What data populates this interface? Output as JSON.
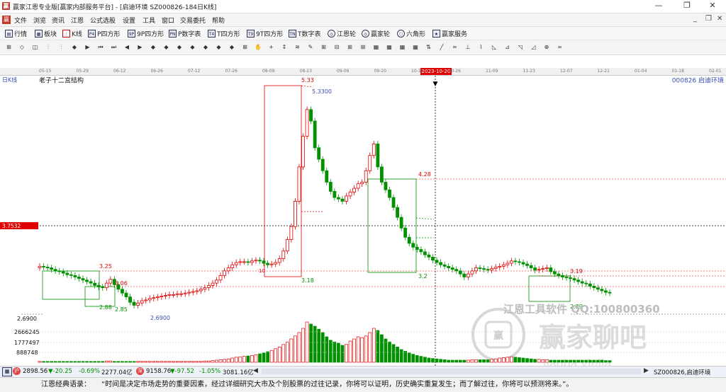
{
  "window": {
    "title": "赢家江恩专业版[赢家内部服务平台] - [启迪环境  SZ000826-184日K线]",
    "controls": [
      "—",
      "❐",
      "✕"
    ]
  },
  "menubar": {
    "items": [
      "文件",
      "浏览",
      "资讯",
      "江恩",
      "公式选股",
      "设置",
      "工具",
      "窗口",
      "交易委托",
      "帮助"
    ],
    "mdi_controls": [
      "_",
      "❐",
      "✕"
    ]
  },
  "toolbar": {
    "items": [
      {
        "label": "行情",
        "icon": "quote-icon"
      },
      {
        "label": "板块",
        "icon": "sector-icon"
      },
      {
        "label": "K线",
        "icon": "kline-icon"
      },
      {
        "label": "P四方形",
        "icon": "p-square-icon",
        "badge": "P4"
      },
      {
        "label": "9P四方形",
        "icon": "9p-square-icon",
        "badge": "9P"
      },
      {
        "label": "P数字表",
        "icon": "p-table-icon",
        "badge": "PN"
      },
      {
        "label": "T四方形",
        "icon": "t-square-icon",
        "badge": "T4"
      },
      {
        "label": "9T四方形",
        "icon": "9t-square-icon",
        "badge": "T9"
      },
      {
        "label": "T数字表",
        "icon": "t-table-icon",
        "badge": "TN"
      },
      {
        "label": "江恩轮",
        "icon": "gann-wheel-icon",
        "badge": "◎"
      },
      {
        "label": "赢家轮",
        "icon": "winner-wheel-icon",
        "badge": "◎"
      },
      {
        "label": "六角形",
        "icon": "hexagon-icon",
        "badge": "⬡"
      },
      {
        "label": "赢家服务",
        "icon": "service-icon",
        "badge": "★"
      }
    ]
  },
  "drawing_tools": [
    "⊞",
    "◇",
    "◫",
    "⫶",
    "⫶",
    "◆",
    "▶",
    "⏮",
    "⏭",
    "◀",
    "▶",
    "◆",
    "◆",
    "◆",
    "◆",
    "◆",
    "◆",
    "◆",
    "⊞",
    "✋",
    "+",
    "↕",
    "≋",
    "✎",
    "⊞",
    "⊟",
    "⊞",
    "⊞",
    "▦",
    "▦",
    "▦",
    "▦",
    "⇅",
    "╱",
    "≈",
    "⊥",
    "⌇",
    "◺",
    "⊿",
    "◹",
    "◿",
    "⊕",
    "∞"
  ],
  "date_axis": {
    "labels": [
      "05-15",
      "05-29",
      "06-12",
      "06-26",
      "07-12",
      "07-26",
      "08-09",
      "08-23",
      "09-06",
      "09-20",
      "10-12",
      "10-26",
      "11-09",
      "11-23",
      "12-07",
      "12-21",
      "01-04",
      "01-18",
      "02-01"
    ],
    "selected": "2023-10-20"
  },
  "chart": {
    "period_label": "日K线",
    "study_name": "老子十二宫结构",
    "stock": "000826  启迪环境",
    "crosshair_price": "3.7532",
    "ylabel_left": "2.6900",
    "volume_ticks": [
      "2666245",
      "1777497",
      "888748"
    ],
    "annotations": {
      "high": "5.33",
      "high_label": "5.3300",
      "low_label": "2.6900",
      "box_labels": [
        "3.25",
        "3.06",
        "2.88",
        "2.85",
        "3.18",
        "4.28",
        "3.19",
        "2.89",
        "3.2"
      ],
      "extra": "10"
    },
    "watermark_text": "江恩工具软件  QQ:100800360",
    "watermark_logo_text": "赢家聊吧",
    "watermark_url": "liaoba.yinjia"
  },
  "chart_data": {
    "type": "candlestick",
    "colors": {
      "up": "#e00000",
      "down": "#009000"
    },
    "closes": [
      3.2,
      3.19,
      3.18,
      3.16,
      3.14,
      3.13,
      3.11,
      3.09,
      3.08,
      3.06,
      3.04,
      3.02,
      3.0,
      2.98,
      2.95,
      2.93,
      2.92,
      2.98,
      3.03,
      2.96,
      2.9,
      2.85,
      2.8,
      2.73,
      2.69,
      2.72,
      2.75,
      2.76,
      2.78,
      2.79,
      2.8,
      2.81,
      2.82,
      2.83,
      2.83,
      2.84,
      2.84,
      2.85,
      2.86,
      2.87,
      2.88,
      2.9,
      2.92,
      2.95,
      2.98,
      3.02,
      3.08,
      3.14,
      3.18,
      3.22,
      3.25,
      3.26,
      3.26,
      3.25,
      3.27,
      3.28,
      3.27,
      3.24,
      3.22,
      3.23,
      3.25,
      3.3,
      3.4,
      3.55,
      3.72,
      4.05,
      4.5,
      4.9,
      5.25,
      5.1,
      4.75,
      4.6,
      4.45,
      4.3,
      4.18,
      4.1,
      4.08,
      4.05,
      4.12,
      4.17,
      4.22,
      4.28,
      4.3,
      4.45,
      4.65,
      4.8,
      4.5,
      4.3,
      4.2,
      4.1,
      3.97,
      3.84,
      3.7,
      3.58,
      3.5,
      3.45,
      3.42,
      3.39,
      3.35,
      3.32,
      3.28,
      3.25,
      3.22,
      3.2,
      3.18,
      3.16,
      3.14,
      3.1,
      3.06,
      3.1,
      3.14,
      3.18,
      3.17,
      3.16,
      3.15,
      3.17,
      3.19,
      3.2,
      3.22,
      3.24,
      3.27,
      3.26,
      3.25,
      3.23,
      3.21,
      3.18,
      3.15,
      3.16,
      3.17,
      3.18,
      3.13,
      3.1,
      3.08,
      3.06,
      3.05,
      3.04,
      3.02,
      3.0,
      2.98,
      2.97,
      2.94,
      2.92,
      2.9,
      2.88,
      2.86,
      2.85
    ],
    "volumes": [
      0.02,
      0.02,
      0.02,
      0.02,
      0.02,
      0.02,
      0.02,
      0.02,
      0.02,
      0.02,
      0.02,
      0.02,
      0.02,
      0.02,
      0.02,
      0.02,
      0.02,
      0.03,
      0.03,
      0.02,
      0.02,
      0.02,
      0.02,
      0.02,
      0.02,
      0.02,
      0.02,
      0.02,
      0.02,
      0.02,
      0.02,
      0.02,
      0.02,
      0.02,
      0.02,
      0.02,
      0.02,
      0.02,
      0.02,
      0.02,
      0.02,
      0.02,
      0.03,
      0.03,
      0.04,
      0.05,
      0.06,
      0.07,
      0.08,
      0.1,
      0.12,
      0.13,
      0.14,
      0.15,
      0.16,
      0.18,
      0.2,
      0.22,
      0.25,
      0.28,
      0.32,
      0.36,
      0.42,
      0.48,
      0.55,
      0.62,
      0.7,
      0.8,
      0.95,
      0.9,
      0.85,
      0.78,
      0.7,
      0.6,
      0.52,
      0.48,
      0.45,
      0.4,
      0.42,
      0.5,
      0.55,
      0.6,
      0.58,
      0.62,
      0.7,
      0.8,
      0.75,
      0.65,
      0.55,
      0.48,
      0.42,
      0.36,
      0.3,
      0.26,
      0.22,
      0.19,
      0.16,
      0.14,
      0.12,
      0.1,
      0.09,
      0.08,
      0.07,
      0.06,
      0.05,
      0.05,
      0.05,
      0.05,
      0.05,
      0.05,
      0.06,
      0.06,
      0.06,
      0.06,
      0.06,
      0.07,
      0.08,
      0.1,
      0.11,
      0.12,
      0.13,
      0.12,
      0.11,
      0.1,
      0.09,
      0.08,
      0.07,
      0.07,
      0.06,
      0.06,
      0.05,
      0.05,
      0.05,
      0.05,
      0.05,
      0.05,
      0.05,
      0.05,
      0.05,
      0.05,
      0.05,
      0.05,
      0.05,
      0.05,
      0.04,
      0.04
    ],
    "ylim": [
      2.5,
      5.6
    ],
    "volume_max": 3500000
  },
  "status": {
    "sh_badge": "沪",
    "sh_index": "2898.56",
    "sh_change": "▼-20.25",
    "sh_pct": "-0.69%",
    "sh_amount": "2277.04亿",
    "sz_badge": "深",
    "sz_index": "9158.76",
    "sz_change": "▼-97.52",
    "sz_pct": "-1.05%",
    "sz_amount": "3081.16亿",
    "right_stock": "SZ000826,启迪环境"
  },
  "quote": {
    "prefix": "江恩经典语录：",
    "text": "“时间是决定市场走势的重要因素，经过详细研究大市及个别股票的过往记录，你将可以证明，历史确实重复发生；而了解过往，你将可以预测将来。”。"
  }
}
